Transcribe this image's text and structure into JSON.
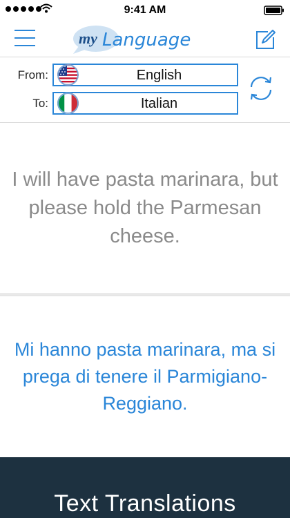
{
  "status_bar": {
    "time": "9:41 AM"
  },
  "header": {
    "logo_prefix": "my",
    "logo_word": "Language"
  },
  "languages": {
    "from_label": "From:",
    "from_value": "English",
    "to_label": "To:",
    "to_value": "Italian"
  },
  "translation": {
    "source_text": "I will have pasta marinara, but please hold the Parmesan cheese.",
    "target_text": "Mi hanno pasta marinara, ma si prega di tenere il Parmigiano-Reggiano."
  },
  "banner": {
    "title": "Text Translations"
  },
  "colors": {
    "accent": "#2a86d8",
    "banner_bg": "#1d3140",
    "source_text": "#8a8a8a"
  },
  "icons": [
    "signal-dots-icon",
    "wifi-icon",
    "battery-icon",
    "hamburger-menu-icon",
    "compose-icon",
    "us-flag-icon",
    "italy-flag-icon",
    "swap-icon"
  ]
}
